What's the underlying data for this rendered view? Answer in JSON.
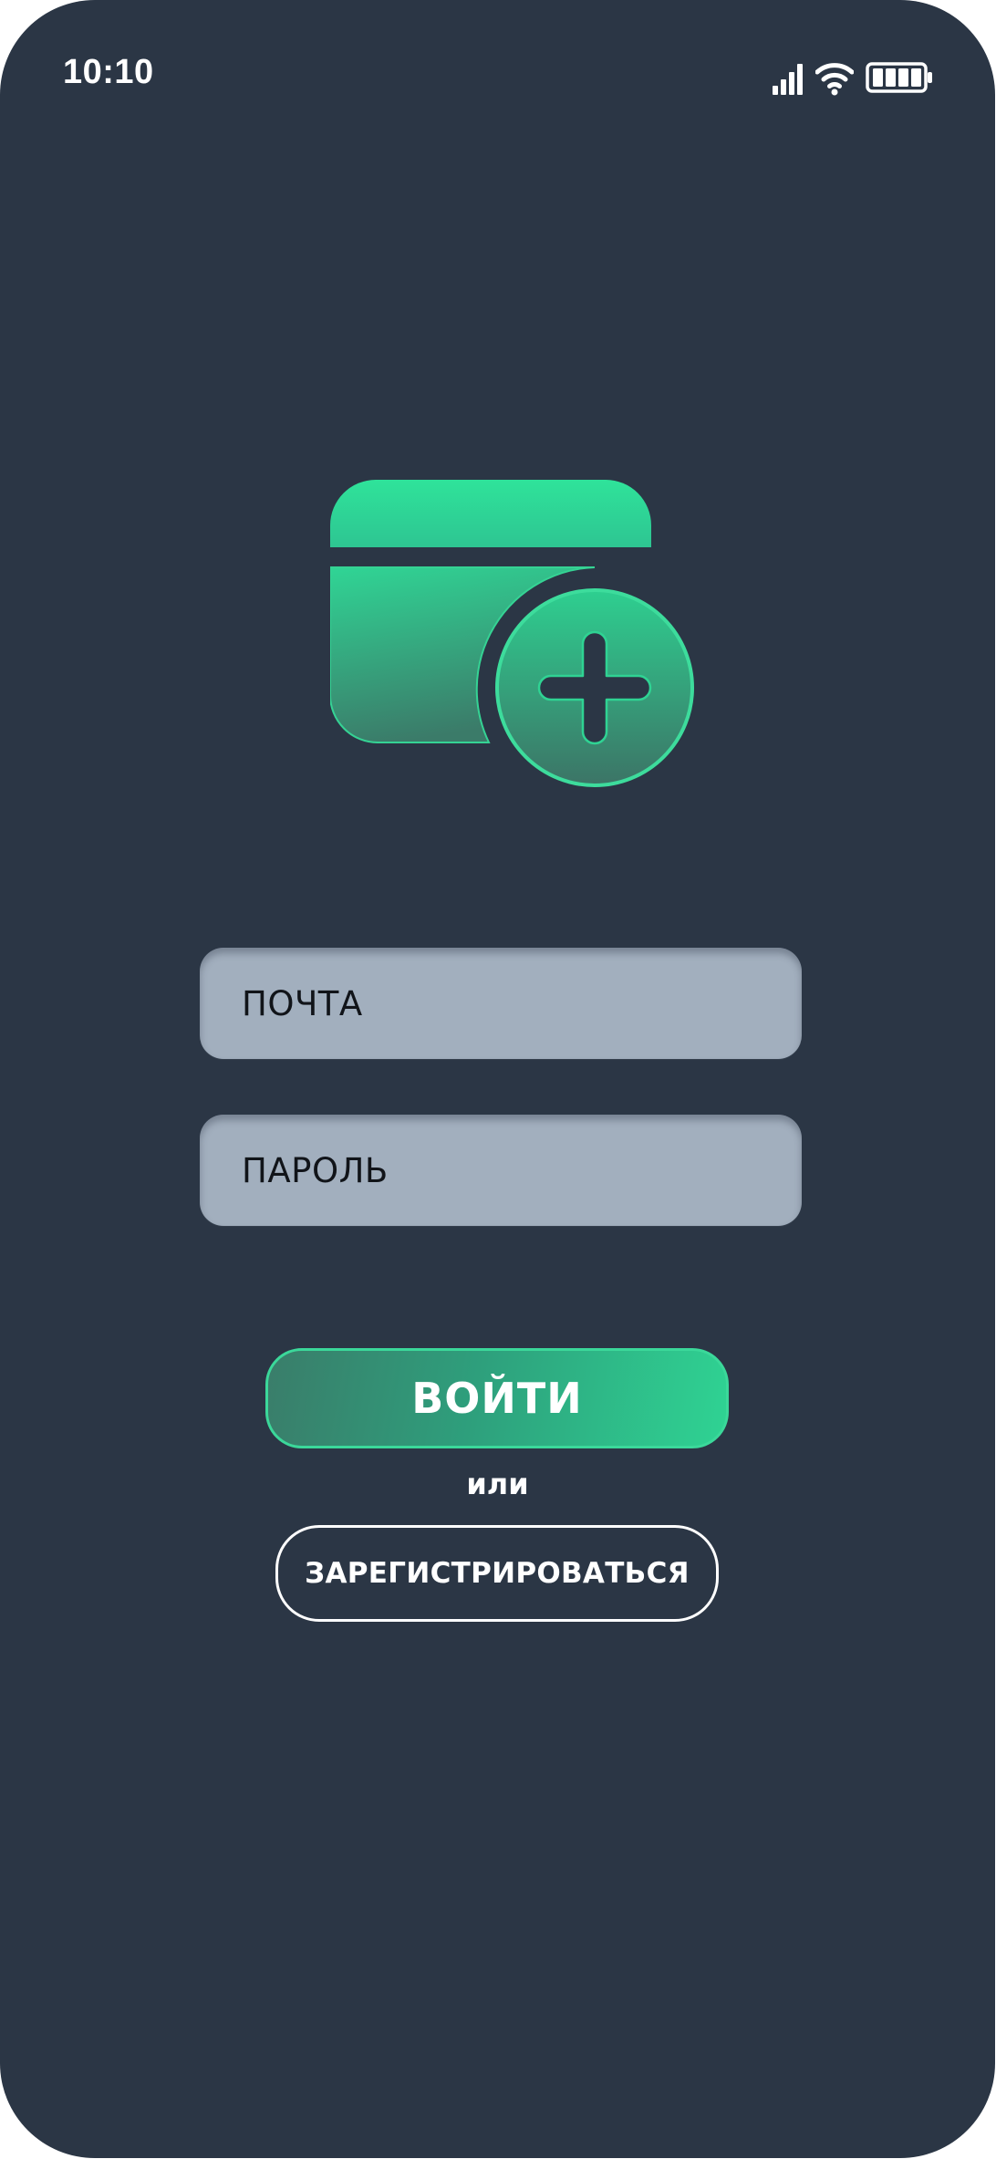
{
  "status_bar": {
    "time": "10:10",
    "icons": [
      "cellular-signal-icon",
      "wifi-icon",
      "battery-icon"
    ]
  },
  "app_logo": {
    "icon": "wallet-add-icon",
    "colors": {
      "gradient_light": "#2fe39a",
      "gradient_dark": "#3d7566"
    }
  },
  "login_form": {
    "email_placeholder": "ПОЧТА",
    "password_placeholder": "ПАРОЛЬ",
    "login_label": "ВОЙТИ",
    "or_text": "или",
    "register_label": "ЗАРЕГИСТРИРОВАТЬСЯ"
  },
  "colors": {
    "background": "#2b3645",
    "field": "#a2afbe",
    "accent": "#2fd393"
  }
}
